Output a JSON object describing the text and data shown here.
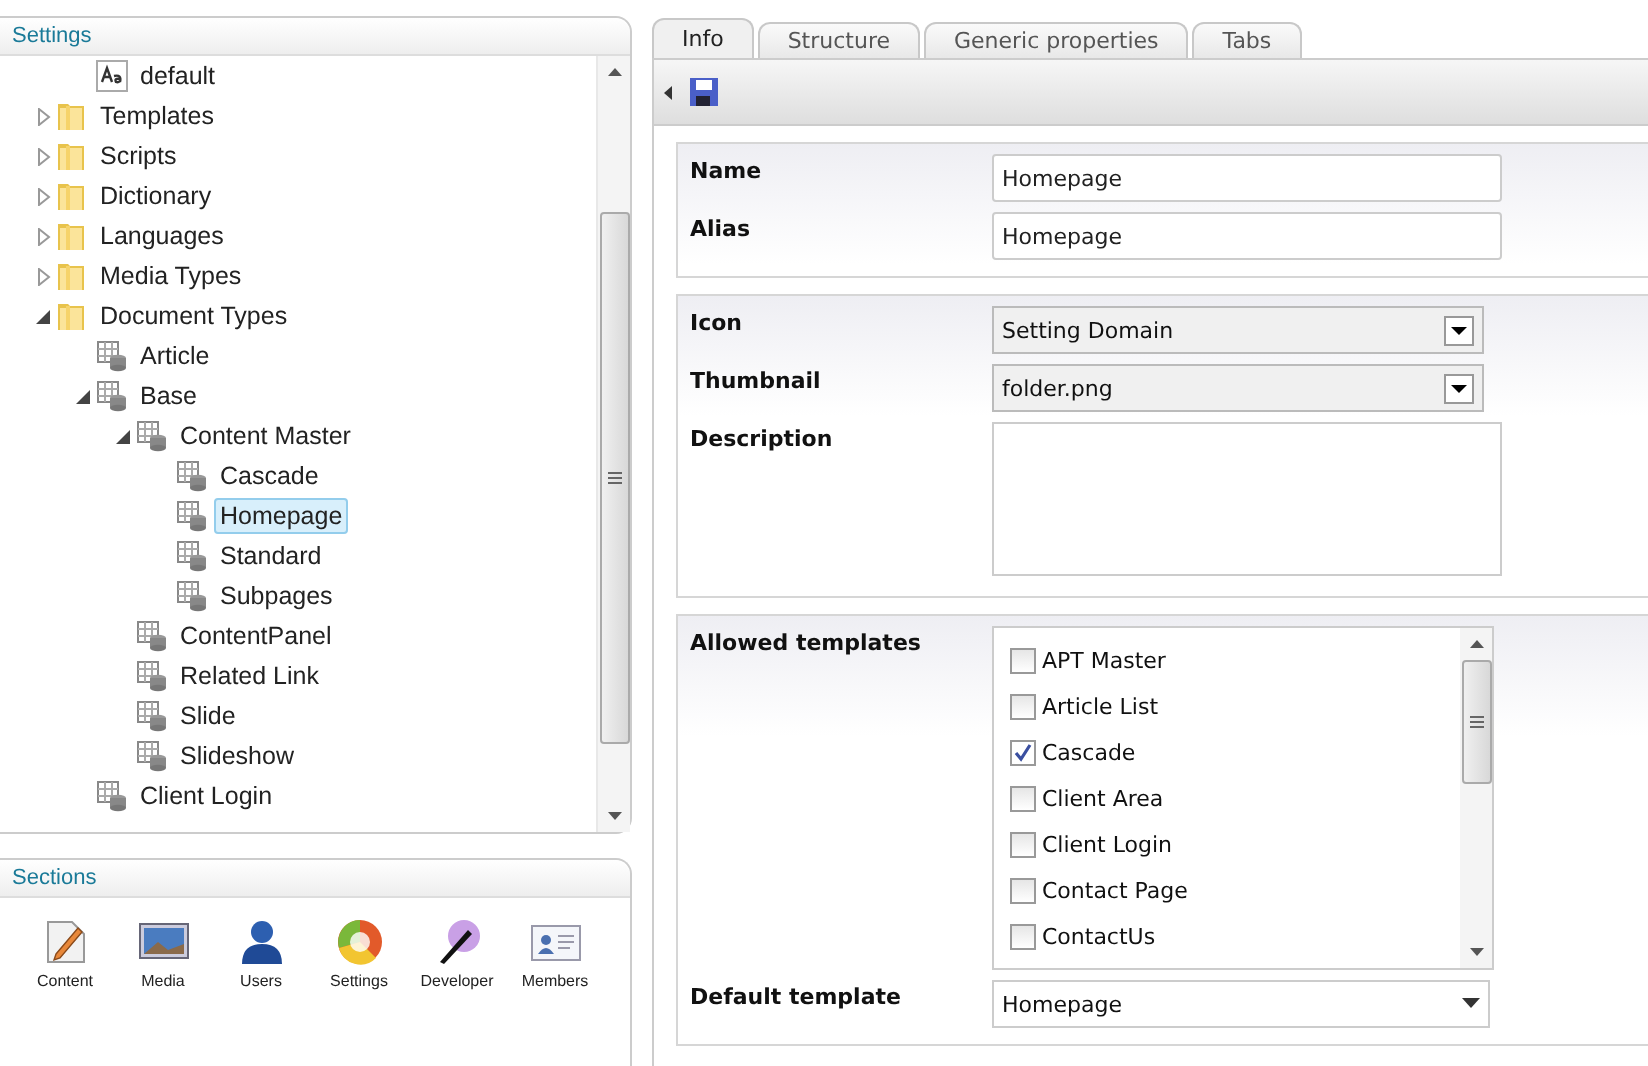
{
  "settings_panel": {
    "title": "Settings",
    "tree": [
      {
        "label": "default",
        "kind": "stylesheet",
        "selected": false
      },
      {
        "label": "Templates",
        "kind": "folder",
        "expanded": false,
        "selected": false
      },
      {
        "label": "Scripts",
        "kind": "folder",
        "expanded": false,
        "selected": false
      },
      {
        "label": "Dictionary",
        "kind": "folder",
        "expanded": false,
        "selected": false
      },
      {
        "label": "Languages",
        "kind": "folder",
        "expanded": false,
        "selected": false
      },
      {
        "label": "Media Types",
        "kind": "folder",
        "expanded": false,
        "selected": false
      },
      {
        "label": "Document Types",
        "kind": "folder",
        "expanded": true,
        "selected": false,
        "children": [
          {
            "label": "Article",
            "kind": "doctype",
            "selected": false
          },
          {
            "label": "Base",
            "kind": "doctype",
            "expanded": true,
            "selected": false,
            "children": [
              {
                "label": "Content Master",
                "kind": "doctype",
                "expanded": true,
                "selected": false,
                "children": [
                  {
                    "label": "Cascade",
                    "kind": "doctype",
                    "selected": false
                  },
                  {
                    "label": "Homepage",
                    "kind": "doctype",
                    "selected": true
                  },
                  {
                    "label": "Standard",
                    "kind": "doctype",
                    "selected": false
                  },
                  {
                    "label": "Subpages",
                    "kind": "doctype",
                    "selected": false
                  }
                ]
              },
              {
                "label": "ContentPanel",
                "kind": "doctype",
                "selected": false
              },
              {
                "label": "Related Link",
                "kind": "doctype",
                "selected": false
              },
              {
                "label": "Slide",
                "kind": "doctype",
                "selected": false
              },
              {
                "label": "Slideshow",
                "kind": "doctype",
                "selected": false
              }
            ]
          },
          {
            "label": "Client Login",
            "kind": "doctype",
            "selected": false
          }
        ]
      }
    ]
  },
  "sections_panel": {
    "title": "Sections",
    "items": [
      {
        "label": "Content",
        "kind": "content"
      },
      {
        "label": "Media",
        "kind": "media"
      },
      {
        "label": "Users",
        "kind": "users"
      },
      {
        "label": "Settings",
        "kind": "settings"
      },
      {
        "label": "Developer",
        "kind": "developer"
      },
      {
        "label": "Members",
        "kind": "members"
      }
    ]
  },
  "tabs": [
    {
      "label": "Info",
      "selected": true
    },
    {
      "label": "Structure",
      "selected": false
    },
    {
      "label": "Generic properties",
      "selected": false
    },
    {
      "label": "Tabs",
      "selected": false
    }
  ],
  "info_form": {
    "name": {
      "label": "Name",
      "value": "Homepage"
    },
    "alias": {
      "label": "Alias",
      "value": "Homepage"
    },
    "icon": {
      "label": "Icon",
      "value": "Setting Domain"
    },
    "thumbnail": {
      "label": "Thumbnail",
      "value": "folder.png"
    },
    "description": {
      "label": "Description"
    },
    "allowed_templates": {
      "label": "Allowed templates",
      "items": [
        {
          "label": "APT Master",
          "checked": false
        },
        {
          "label": "Article List",
          "checked": false
        },
        {
          "label": "Cascade",
          "checked": true
        },
        {
          "label": "Client Area",
          "checked": false
        },
        {
          "label": "Client Login",
          "checked": false
        },
        {
          "label": "Contact Page",
          "checked": false
        },
        {
          "label": "ContactUs",
          "checked": false
        }
      ]
    },
    "default_template": {
      "label": "Default template",
      "value": "Homepage"
    }
  }
}
